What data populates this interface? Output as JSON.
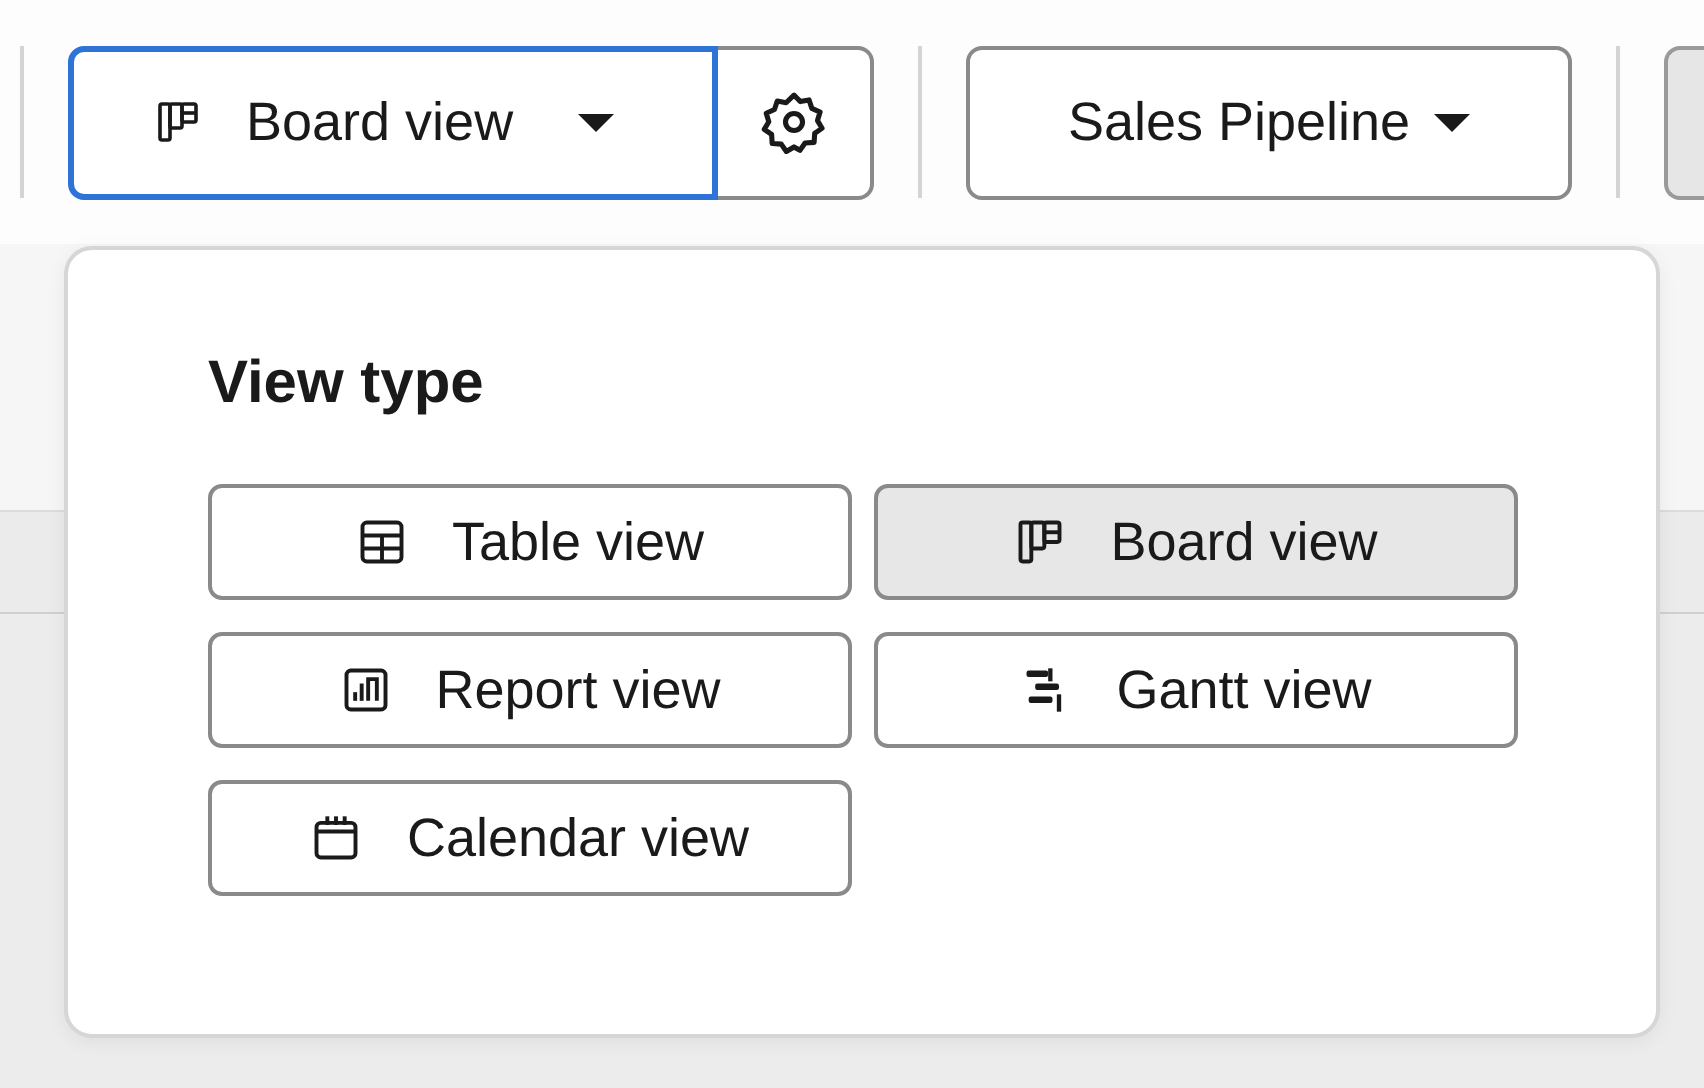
{
  "toolbar": {
    "view_button": {
      "label": "Board view",
      "kind": "board",
      "focused": true
    },
    "settings_button": {
      "kind": "gear"
    },
    "pipeline_button": {
      "label": "Sales Pipeline"
    }
  },
  "popup": {
    "title": "View type",
    "options": [
      {
        "label": "Table view",
        "kind": "table",
        "selected": false
      },
      {
        "label": "Board view",
        "kind": "board",
        "selected": true
      },
      {
        "label": "Report view",
        "kind": "report",
        "selected": false
      },
      {
        "label": "Gantt view",
        "kind": "gantt",
        "selected": false
      },
      {
        "label": "Calendar view",
        "kind": "calendar",
        "selected": false
      }
    ]
  }
}
